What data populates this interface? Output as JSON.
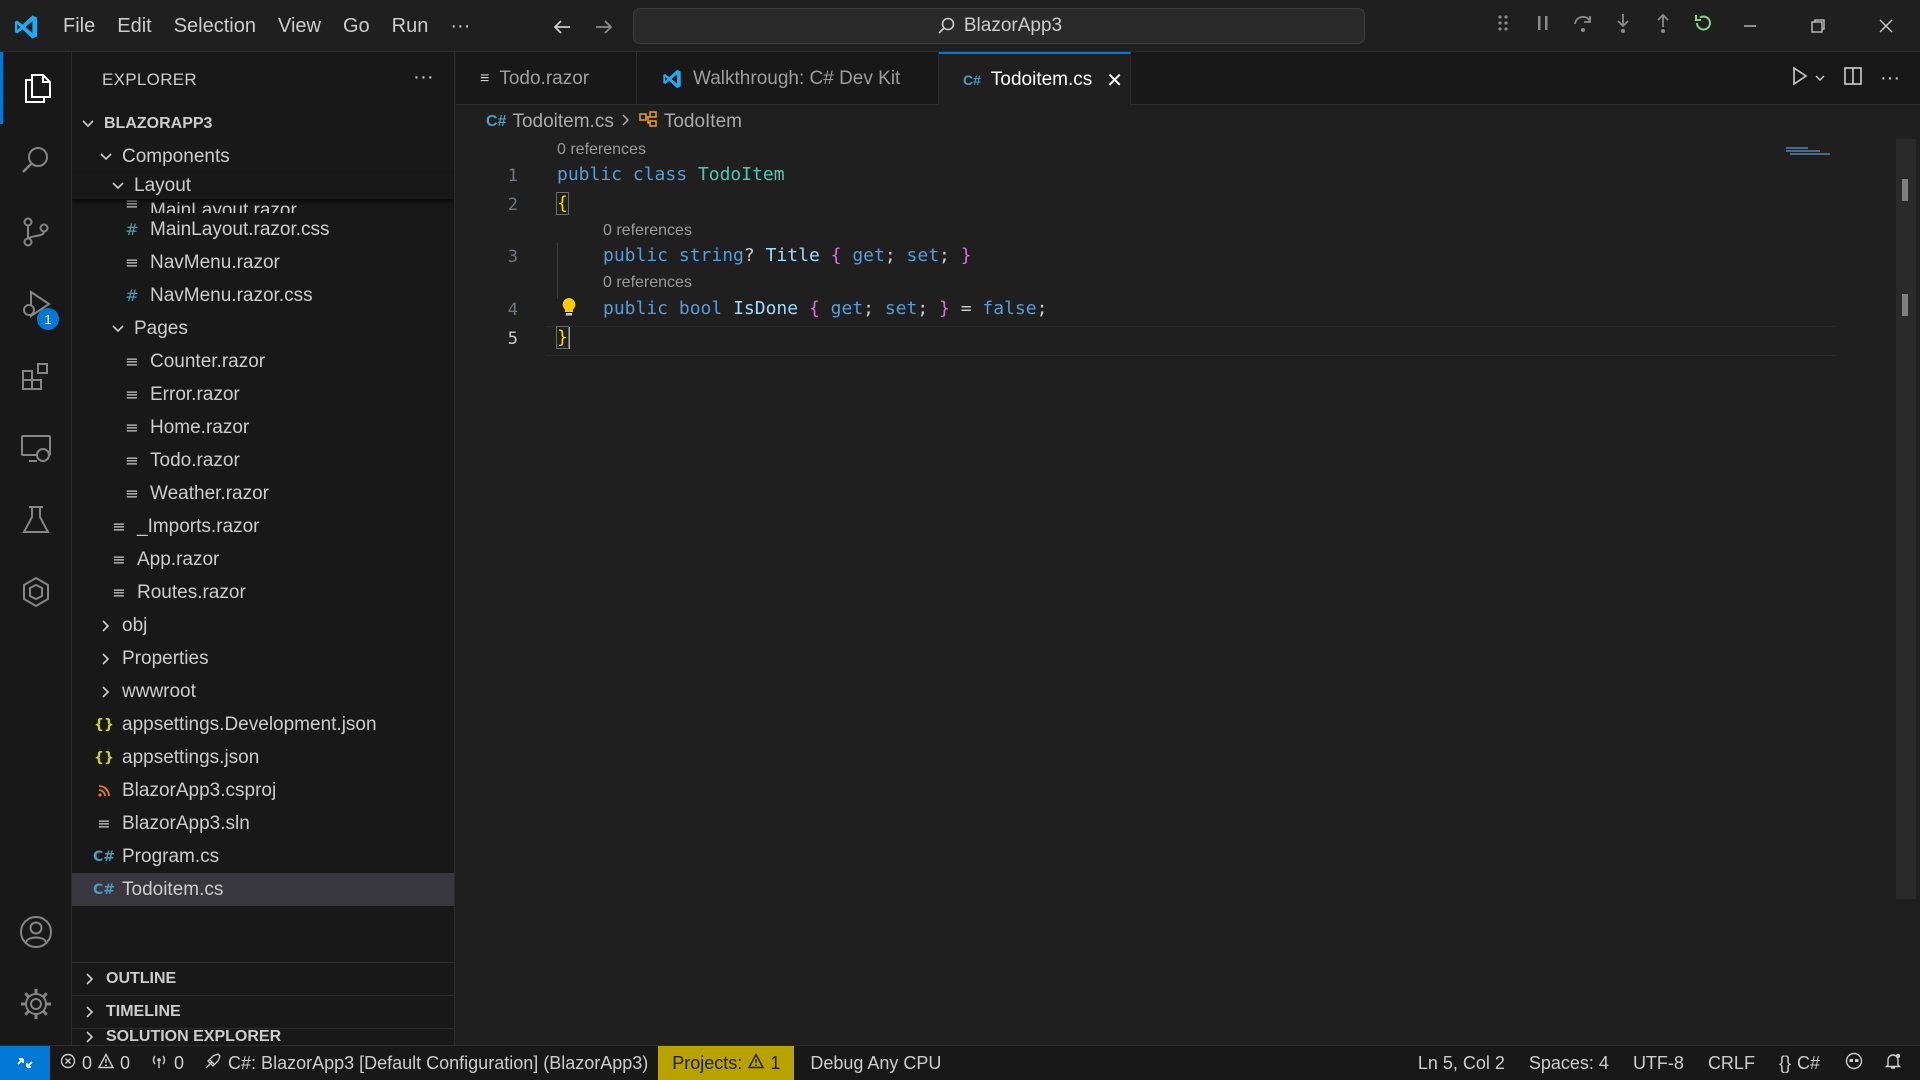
{
  "titlebar": {
    "menu": [
      "File",
      "Edit",
      "Selection",
      "View",
      "Go",
      "Run",
      "···"
    ],
    "search_text": "BlazorApp3"
  },
  "activity": {
    "run_badge": "1"
  },
  "explorer": {
    "header": "EXPLORER",
    "root": "BLAZORAPP3",
    "components": "Components",
    "layout": "Layout",
    "partial_row": "MainLayout.razor",
    "rows": [
      {
        "label": "MainLayout.razor.css",
        "icon": "#"
      },
      {
        "label": "NavMenu.razor",
        "icon": "≡"
      },
      {
        "label": "NavMenu.razor.css",
        "icon": "#"
      }
    ],
    "pages": "Pages",
    "page_files": [
      "Counter.razor",
      "Error.razor",
      "Home.razor",
      "Todo.razor",
      "Weather.razor"
    ],
    "component_files": [
      "_Imports.razor",
      "App.razor",
      "Routes.razor"
    ],
    "folders": [
      "obj",
      "Properties",
      "wwwroot"
    ],
    "root_files": [
      {
        "label": "appsettings.Development.json",
        "icon": "{}"
      },
      {
        "label": "appsettings.json",
        "icon": "{}"
      },
      {
        "label": "BlazorApp3.csproj",
        "icon": "rss"
      },
      {
        "label": "BlazorApp3.sln",
        "icon": "≡"
      },
      {
        "label": "Program.cs",
        "icon": "C#"
      },
      {
        "label": "Todoitem.cs",
        "icon": "C#"
      }
    ],
    "sections": [
      "OUTLINE",
      "TIMELINE",
      "SOLUTION EXPLORER"
    ]
  },
  "tabs": [
    {
      "label": "Todo.razor",
      "icon": "≡"
    },
    {
      "label": "Walkthrough: C# Dev Kit",
      "icon": "vscode"
    },
    {
      "label": "Todoitem.cs",
      "icon": "C#"
    }
  ],
  "breadcrumb": {
    "file": "Todoitem.cs",
    "symbol": "TodoItem"
  },
  "editor": {
    "references": "0 references",
    "line_numbers": [
      "1",
      "2",
      "3",
      "4",
      "5"
    ],
    "line1": {
      "kw1": "public",
      "kw2": "class",
      "name": "TodoItem"
    },
    "line2": "{",
    "line3": {
      "kw1": "public",
      "type": "string",
      "q": "?",
      "name": "Title",
      "open": "{",
      "get": "get",
      "semi1": ";",
      "set": "set",
      "semi2": ";",
      "close": "}"
    },
    "line4": {
      "kw1": "public",
      "type": "bool",
      "name": "IsDone",
      "open": "{",
      "get": "get",
      "semi1": ";",
      "set": "set",
      "semi2": ";",
      "close": "}",
      "eq": " = ",
      "val": "false",
      "end": ";"
    },
    "line5": "}"
  },
  "status": {
    "errors": "0",
    "warnings": "0",
    "ports": "0",
    "project": "C#: BlazorApp3 [Default Configuration] (BlazorApp3)",
    "projects_label": "Projects:",
    "projects_count": "1",
    "debug": "Debug Any CPU",
    "position": "Ln 5, Col 2",
    "spaces": "Spaces: 4",
    "encoding": "UTF-8",
    "eol": "CRLF",
    "language": "C#",
    "language_icon": "{}"
  },
  "colors": {
    "accent": "#0078d4",
    "csharp_icon": "#519aba",
    "warning_bg": "#b8a200"
  }
}
